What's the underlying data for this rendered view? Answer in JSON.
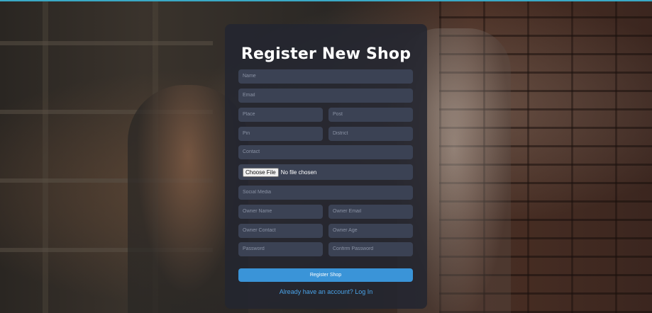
{
  "form": {
    "title": "Register New Shop",
    "fields": {
      "name": {
        "placeholder": "Name",
        "value": ""
      },
      "email": {
        "placeholder": "Email",
        "value": ""
      },
      "place": {
        "placeholder": "Place",
        "value": ""
      },
      "post": {
        "placeholder": "Post",
        "value": ""
      },
      "pin": {
        "placeholder": "Pin",
        "value": ""
      },
      "district": {
        "placeholder": "District",
        "value": ""
      },
      "contact": {
        "placeholder": "Contact",
        "value": ""
      },
      "social_media": {
        "placeholder": "Social Media",
        "value": ""
      },
      "owner_name": {
        "placeholder": "Owner Name",
        "value": ""
      },
      "owner_email": {
        "placeholder": "Owner Email",
        "value": ""
      },
      "owner_contact": {
        "placeholder": "Owner Contact",
        "value": ""
      },
      "owner_age": {
        "placeholder": "Owner Age",
        "value": ""
      },
      "password": {
        "placeholder": "Password",
        "value": ""
      },
      "confirm_password": {
        "placeholder": "Confirm Password",
        "value": ""
      }
    },
    "file": {
      "button_label": "Choose File",
      "status": "No file chosen"
    },
    "submit_label": "Register Shop",
    "login_link": "Already have an account? Log In"
  },
  "colors": {
    "card": "#23263099",
    "input": "#3b4254",
    "accent": "#3a94d8",
    "link": "#4aa3e8"
  }
}
